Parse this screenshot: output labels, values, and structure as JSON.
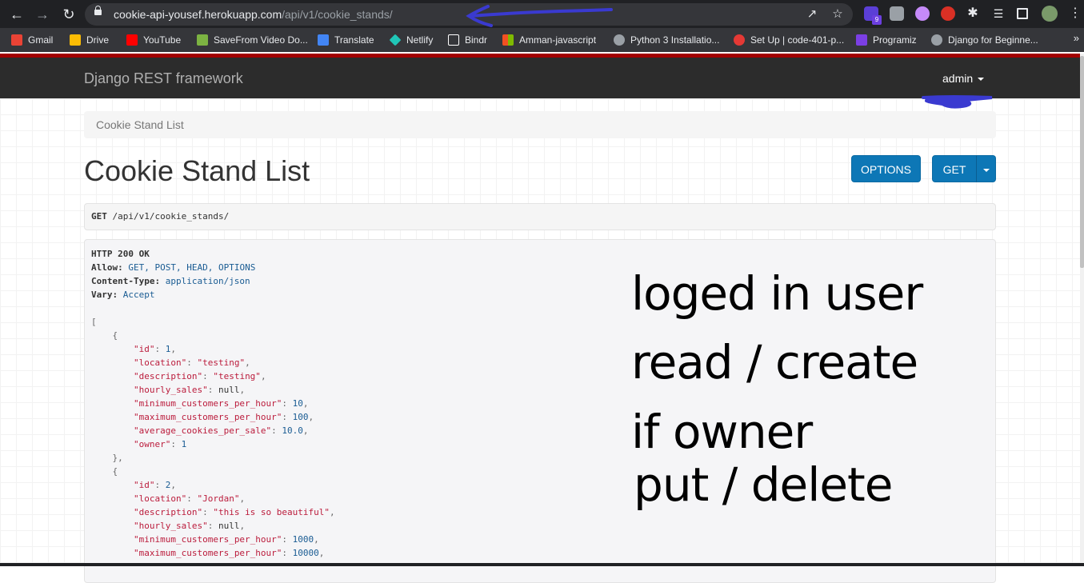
{
  "browser": {
    "url_host": "cookie-api-yousef.herokuapp.com",
    "url_path": "/api/v1/cookie_stands/",
    "extension_badge": "9"
  },
  "bookmarks": [
    {
      "label": "Gmail",
      "color": "#ea4335"
    },
    {
      "label": "Drive",
      "color": "#fbbc04"
    },
    {
      "label": "YouTube",
      "color": "#ff0000"
    },
    {
      "label": "SaveFrom Video Do...",
      "color": "#7cb342"
    },
    {
      "label": "Translate",
      "color": "#4285f4"
    },
    {
      "label": "Netlify",
      "color": "#20c6b7"
    },
    {
      "label": "Bindr",
      "color": "#ffffff"
    },
    {
      "label": "Amman-javascript",
      "color": "#f25022"
    },
    {
      "label": "Python 3 Installatio...",
      "color": "#9aa0a6"
    },
    {
      "label": "Set Up | code-401-p...",
      "color": "#e53935"
    },
    {
      "label": "Programiz",
      "color": "#7b3fe4"
    },
    {
      "label": "Django for Beginne...",
      "color": "#9aa0a6"
    }
  ],
  "navbar": {
    "brand": "Django REST framework",
    "user": "admin"
  },
  "breadcrumb": "Cookie Stand List",
  "page": {
    "title": "Cookie Stand List",
    "options_label": "OPTIONS",
    "get_label": "GET"
  },
  "request": {
    "method": "GET",
    "path": "/api/v1/cookie_stands/"
  },
  "response": {
    "status": "HTTP 200 OK",
    "headers": [
      {
        "name": "Allow:",
        "value": "GET, POST, HEAD, OPTIONS"
      },
      {
        "name": "Content-Type:",
        "value": "application/json"
      },
      {
        "name": "Vary:",
        "value": "Accept"
      }
    ],
    "items": [
      {
        "id": "1",
        "location": "\"testing\"",
        "description": "\"testing\"",
        "hourly_sales": "null",
        "minimum_customers_per_hour": "10",
        "maximum_customers_per_hour": "100",
        "average_cookies_per_sale": "10.0",
        "owner": "1"
      },
      {
        "id": "2",
        "location": "\"Jordan\"",
        "description": "\"this is so beautiful\"",
        "hourly_sales": "null",
        "minimum_customers_per_hour": "1000",
        "maximum_customers_per_hour": "10000"
      }
    ]
  },
  "annotations": {
    "line1": "loged in user",
    "line2": "read / create",
    "line3": "if owner",
    "line4": "put / delete"
  },
  "colors": {
    "accent": "#0d77b6",
    "navbar": "#2c2c2c",
    "scribble": "#3a3ad0"
  }
}
